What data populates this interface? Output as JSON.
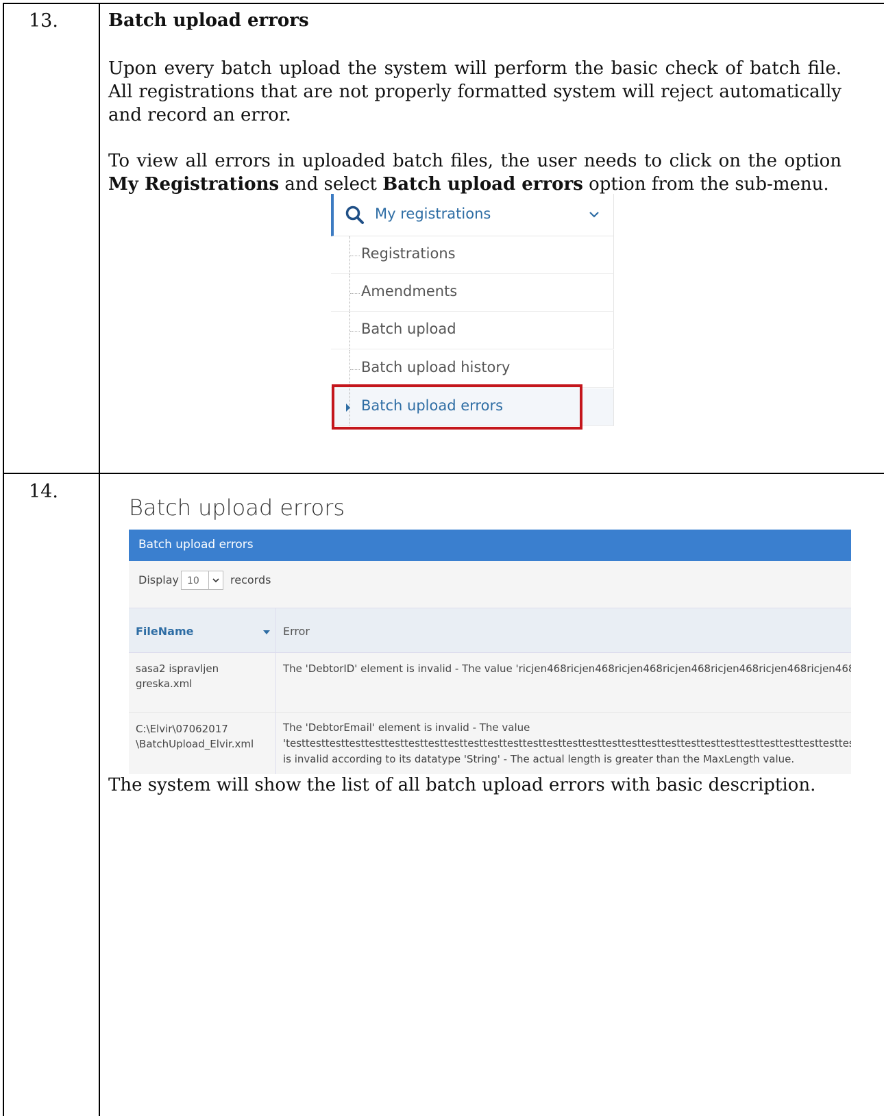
{
  "step13": {
    "number": "13.",
    "heading": "Batch upload errors",
    "para1": "Upon every batch upload the system will perform  the basic check of batch file. All registrations that are not properly formatted system will reject automatically and record an error.",
    "para2": {
      "part1": "To view all errors in uploaded batch files, the user needs to click on the option ",
      "bold1": "My Registrations",
      "part2": " and select ",
      "bold2": "Batch upload errors",
      "part3": " option from the sub-menu."
    },
    "menu": {
      "header_label": "My registrations",
      "items": [
        {
          "label": "Registrations"
        },
        {
          "label": "Amendments"
        },
        {
          "label": "Batch upload"
        },
        {
          "label": "Batch upload history"
        },
        {
          "label": "Batch upload errors",
          "active": true
        }
      ],
      "accent_color": "#3c7bc2",
      "highlight_color": "#c4161c"
    }
  },
  "step14": {
    "number": "14.",
    "screenshot": {
      "page_title": "Batch upload errors",
      "panel_title": "Batch upload errors",
      "display_label": "Display",
      "display_value": "10",
      "records_label": "records",
      "columns": [
        "FileName",
        "Error"
      ],
      "rows": [
        {
          "file": [
            "sasa2 ispravljen",
            "greska.xml"
          ],
          "error": [
            "The 'DebtorID' element is invalid - The value 'ricjen468ricjen468ricjen468ricjen468ricjen468ricjen468ricjen468ricje"
          ]
        },
        {
          "file": [
            "C:\\Elvir\\07062017",
            "\\BatchUpload_Elvir.xml"
          ],
          "error": [
            "The 'DebtorEmail' element is invalid - The value",
            "'testtesttesttesttesttesttesttesttesttesttesttesttesttesttesttesttesttesttesttesttesttesttesttesttesttesttesttesttesttest",
            "is invalid according to its datatype 'String' - The actual length is greater than the MaxLength value."
          ]
        }
      ],
      "header_color": "#3a7fcf"
    },
    "caption": "The system will show the list of all batch upload errors with basic description."
  }
}
